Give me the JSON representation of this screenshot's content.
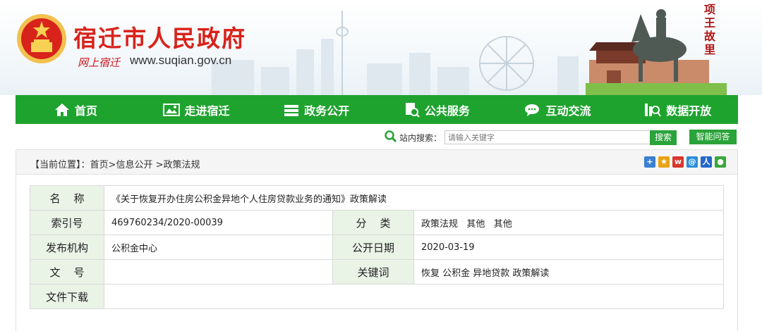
{
  "header": {
    "site_title": "宿迁市人民政府",
    "slogan": "网上宿迁",
    "domain": "www.suqian.gov.cn",
    "calligraphy": "项王故里"
  },
  "colors": {
    "brand_red": "#d8231b",
    "nav_green": "#1fa32f",
    "label_bg": "#e9f3e6"
  },
  "nav": {
    "items": [
      {
        "label": "首页",
        "icon": "home-icon"
      },
      {
        "label": "走进宿迁",
        "icon": "picture-icon"
      },
      {
        "label": "政务公开",
        "icon": "stack-icon"
      },
      {
        "label": "公共服务",
        "icon": "document-search-icon"
      },
      {
        "label": "互动交流",
        "icon": "chat-icon"
      },
      {
        "label": "数据开放",
        "icon": "data-search-icon"
      }
    ]
  },
  "search": {
    "label": "站内搜索：",
    "placeholder": "请输入关键字",
    "button": "搜索",
    "ai_button": "智能问答"
  },
  "breadcrumb": {
    "prefix": "【当前位置】：",
    "items": [
      "首页",
      "信息公开",
      "政策法规"
    ],
    "sep": ">"
  },
  "info": {
    "name_label": "名    称",
    "name_value": "《关于恢复开办住房公积金异地个人住房贷款业务的通知》政策解读",
    "index_label": "索引号",
    "index_value": "469760234/2020-00039",
    "category_label": "分    类",
    "category_value": "政策法规   其他   其他",
    "org_label": "发布机构",
    "org_value": "公积金中心",
    "date_label": "公开日期",
    "date_value": "2020-03-19",
    "docno_label": "文    号",
    "docno_value": "",
    "keywords_label": "关键词",
    "keywords_value": "恢复 公积金 异地贷款 政策解读",
    "download_label": "文件下载",
    "download_value": ""
  }
}
